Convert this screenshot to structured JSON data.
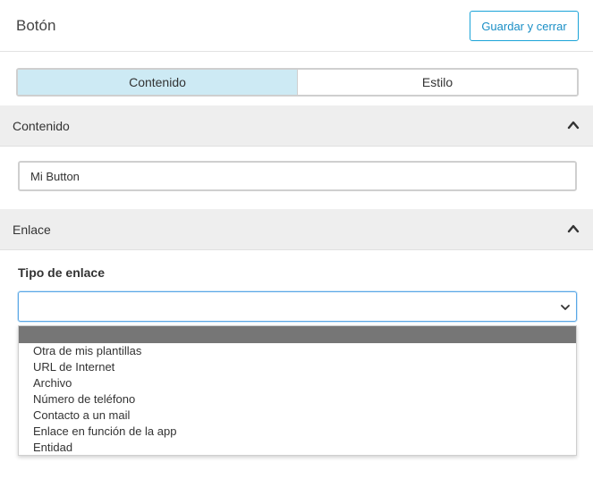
{
  "header": {
    "title": "Botón",
    "save_label": "Guardar y cerrar"
  },
  "tabs": [
    {
      "label": "Contenido",
      "active": true
    },
    {
      "label": "Estilo",
      "active": false
    }
  ],
  "sections": {
    "content": {
      "title": "Contenido",
      "expanded": true,
      "icon": "chevron-up-icon"
    },
    "link": {
      "title": "Enlace",
      "expanded": true,
      "icon": "chevron-up-icon"
    }
  },
  "content_input": {
    "value": "Mi Button"
  },
  "link_type": {
    "label": "Tipo de enlace",
    "selected": "",
    "icon": "chevron-down-icon",
    "options": [
      "",
      "Otra de mis plantillas",
      "URL de Internet",
      "Archivo",
      "Número de teléfono",
      "Contacto a un mail",
      "Enlace en función de la app",
      "Entidad"
    ]
  },
  "colors": {
    "accent": "#1aa3d8",
    "active_tab": "#cdeaf4",
    "section_bg": "#eeeeee",
    "highlight": "#767676"
  }
}
